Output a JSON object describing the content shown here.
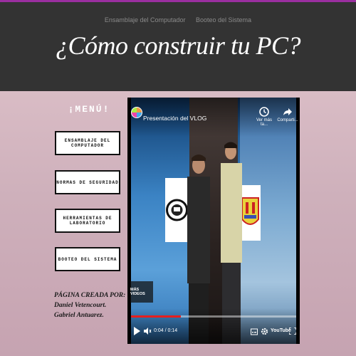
{
  "header": {
    "nav": [
      "Ensamblaje del Computador",
      "Booteo del Sistema"
    ],
    "title": "¿Cómo construir tu PC?"
  },
  "menu": {
    "title": "¡MENÚ!",
    "items": [
      "ENSAMBLAJE DEL COMPUTADOR",
      "NORMAS DE SEGURIDAD",
      "HERRAMIENTAS DE LABORATORIO",
      "BOOTEO DEL SISTEMA"
    ]
  },
  "credits": {
    "line1": "PÁGINA CREADA POR:",
    "line2": "Daniel Vetencourt.",
    "line3": "Gabriel Antuarez."
  },
  "video": {
    "title": "Presentación del VLOG",
    "watch_later": "Ver más ta...",
    "share": "Comparti...",
    "more_videos": "MÁS VIDEOS",
    "time": "0:04 / 0:14",
    "progress": 0.3,
    "platform": "YouTube"
  },
  "colors": {
    "header_bg": "#333333",
    "accent_line": "#9b2fa0",
    "progress": "#e61e1e"
  }
}
